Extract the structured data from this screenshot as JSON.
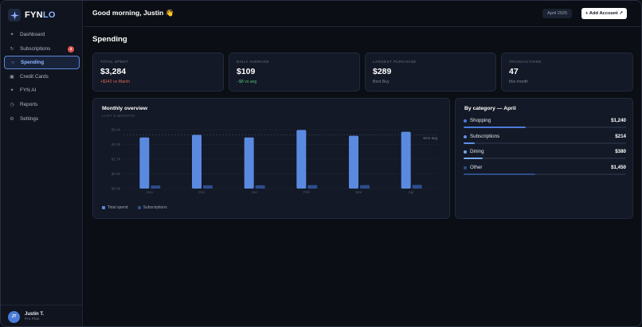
{
  "app": {
    "brand_prefix": "FYN",
    "brand_suffix": "LO"
  },
  "sidebar": {
    "items": [
      {
        "label": "Dashboard",
        "icon": "grid-icon"
      },
      {
        "label": "Subscriptions",
        "icon": "refresh-icon",
        "badge": "3"
      },
      {
        "label": "Spending",
        "icon": "circle-icon",
        "active": true
      },
      {
        "label": "Credit Cards",
        "icon": "card-icon"
      },
      {
        "label": "FYN AI",
        "icon": "sparkle-icon"
      },
      {
        "label": "Reports",
        "icon": "chart-icon"
      },
      {
        "label": "Settings",
        "icon": "gear-icon"
      }
    ],
    "user": {
      "initials": "JT",
      "name": "Justin T.",
      "plan": "Pro Plan"
    }
  },
  "header": {
    "greeting": "Good morning, Justin 👋",
    "date": "April 2025",
    "add_account": "+ Add Account ↗"
  },
  "main": {
    "title": "Spending",
    "stats": [
      {
        "label": "Total spent",
        "value": "$3,284",
        "sub": "+$142 vs March",
        "tone": "red"
      },
      {
        "label": "Daily average",
        "value": "$109",
        "sub": "−$8 vs avg",
        "tone": "green"
      },
      {
        "label": "Largest purchase",
        "value": "$289",
        "sub": "Best Buy",
        "tone": "muted"
      },
      {
        "label": "Transactions",
        "value": "47",
        "sub": "this month",
        "tone": "muted"
      }
    ],
    "overview": {
      "title": "Monthly overview",
      "subtitle": "Last 6 months"
    },
    "category": {
      "title": "By category — April",
      "items": [
        {
          "name": "Shopping",
          "amount": "$1,240",
          "share": 0.38,
          "color": "#4a7bd8"
        },
        {
          "name": "Subscriptions",
          "amount": "$214",
          "share": 0.07,
          "color": "#5f8fe8"
        },
        {
          "name": "Dining",
          "amount": "$380",
          "share": 0.12,
          "color": "#7aa6f0"
        },
        {
          "name": "Other",
          "amount": "$1,450",
          "share": 0.44,
          "color": "#2f4d88"
        }
      ]
    }
  },
  "chart_data": {
    "type": "bar",
    "title": "Monthly overview",
    "subtitle": "Last 6 months",
    "categories": [
      "Nov",
      "Dec",
      "Jan",
      "Feb",
      "Mar",
      "Apr"
    ],
    "series": [
      {
        "name": "Total spend",
        "values": [
          2.95,
          3.1,
          2.95,
          3.38,
          3.05,
          3.28
        ],
        "color": "#5a8ae0"
      },
      {
        "name": "Subscriptions",
        "values": [
          0.18,
          0.19,
          0.19,
          0.2,
          0.2,
          0.21
        ],
        "color": "#2d4d8c"
      }
    ],
    "ytick_labels": [
      "$0.0k",
      "$0.8k",
      "$1.7k",
      "$2.5k",
      "$3.4k"
    ],
    "ylim": [
      0,
      3.4
    ],
    "reference_line": {
      "label": "6mo avg",
      "value": 3.1
    },
    "grid": true,
    "legend": "bottom-left"
  },
  "colors": {
    "accent": "#5d86d6",
    "background": "#0b0e14",
    "panel": "#131926",
    "danger": "#e0675f",
    "success": "#4fc27a"
  }
}
